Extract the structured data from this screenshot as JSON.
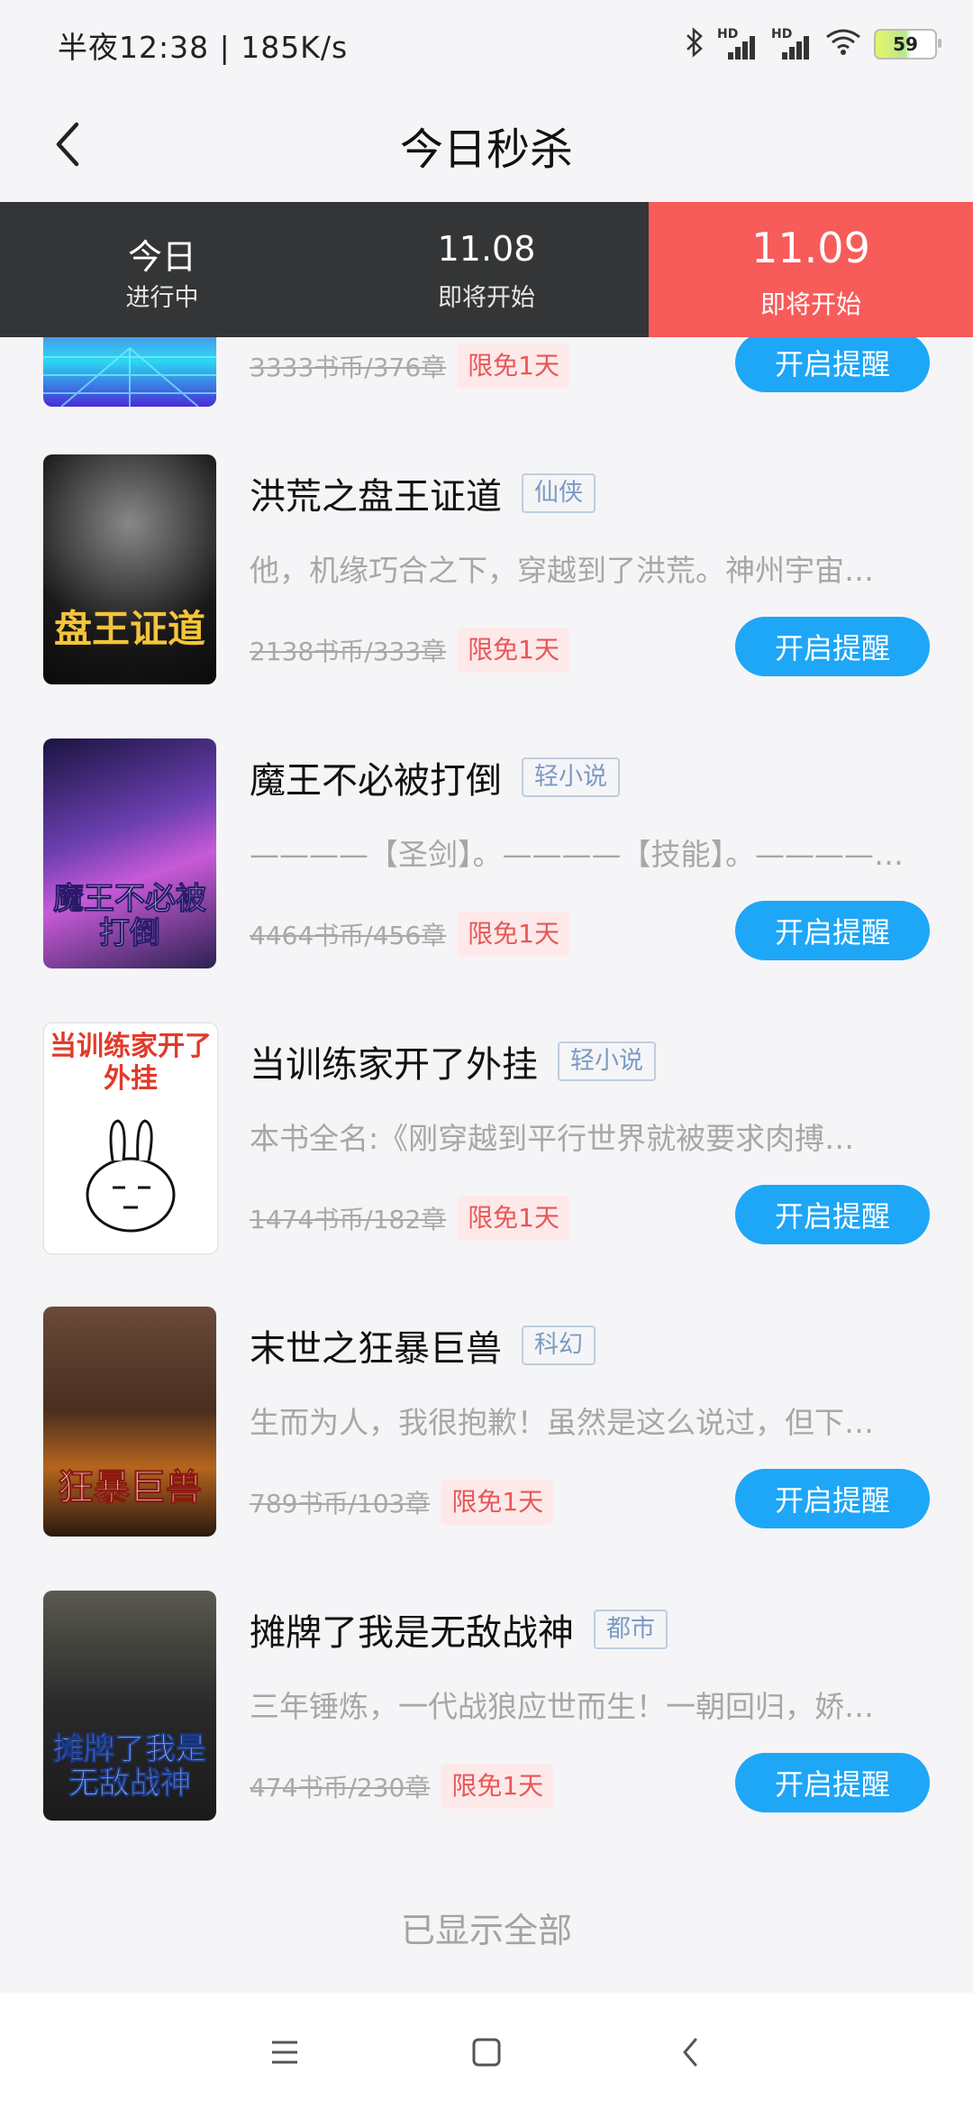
{
  "status_bar": {
    "time": "半夜12:38 | 185K/s",
    "battery": "59",
    "icons": [
      "bluetooth-icon",
      "signal-hd-icon",
      "signal-hd-icon",
      "wifi-icon",
      "battery-icon"
    ]
  },
  "header": {
    "title": "今日秒杀",
    "back_icon": "chevron-left-icon"
  },
  "tabs": [
    {
      "date": "今日",
      "status": "进行中",
      "active": false
    },
    {
      "date": "11.08",
      "status": "即将开始",
      "active": false
    },
    {
      "date": "11.09",
      "status": "即将开始",
      "active": true
    }
  ],
  "books": [
    {
      "title": "",
      "genre": "",
      "desc": "",
      "price": "3333书币/376章",
      "badge": "限免1天",
      "button": "开启提醒"
    },
    {
      "title": "洪荒之盘王证道",
      "genre": "仙侠",
      "desc": "他，机缘巧合之下，穿越到了洪荒。神州宇宙…",
      "price": "2138书币/333章",
      "badge": "限免1天",
      "button": "开启提醒"
    },
    {
      "title": "魔王不必被打倒",
      "genre": "轻小说",
      "desc": "————【圣剑】。————【技能】。————…",
      "price": "4464书币/456章",
      "badge": "限免1天",
      "button": "开启提醒"
    },
    {
      "title": "当训练家开了外挂",
      "genre": "轻小说",
      "desc": "本书全名:《刚穿越到平行世界就被要求肉搏…",
      "price": "1474书币/182章",
      "badge": "限免1天",
      "button": "开启提醒"
    },
    {
      "title": "末世之狂暴巨兽",
      "genre": "科幻",
      "desc": "生而为人，我很抱歉！虽然是这么说过，但下…",
      "price": "789书币/103章",
      "badge": "限免1天",
      "button": "开启提醒"
    },
    {
      "title": "摊牌了我是无敌战神",
      "genre": "都市",
      "desc": "三年锤炼，一代战狼应世而生！一朝回归，娇…",
      "price": "474书币/230章",
      "badge": "限免1天",
      "button": "开启提醒"
    }
  ],
  "covers": [
    {
      "text": "",
      "bg": "#5a2bd8"
    },
    {
      "text": "盘王证道",
      "bg": "#141414"
    },
    {
      "text": "魔王不必被打倒",
      "bg": "#2a2250"
    },
    {
      "text": "当训练家开了外挂",
      "bg": "#ffffff"
    },
    {
      "text": "狂暴巨兽",
      "bg": "#4a2e1f"
    },
    {
      "text": "摊牌了我是无敌战神",
      "bg": "#2a2a2a"
    }
  ],
  "footer": {
    "text": "已显示全部"
  },
  "colors": {
    "accent": "#1ea6f7",
    "tab_active": "#f75b5a",
    "tab_bg": "#333536"
  }
}
